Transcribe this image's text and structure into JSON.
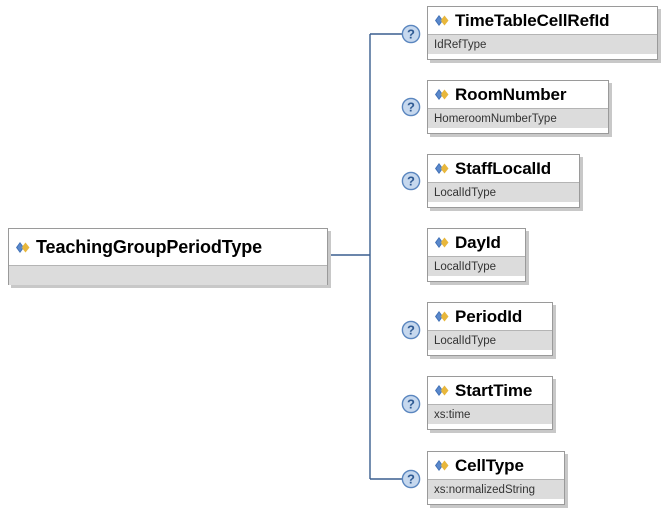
{
  "root": {
    "name": "TeachingGroupPeriodType",
    "type": ""
  },
  "children": [
    {
      "name": "TimeTableCellRefId",
      "type": "IdRefType",
      "optional": true,
      "annotation_icon": "help-question-icon"
    },
    {
      "name": "RoomNumber",
      "type": "HomeroomNumberType",
      "optional": true,
      "annotation_icon": "help-question-icon"
    },
    {
      "name": "StaffLocalId",
      "type": "LocalIdType",
      "optional": true,
      "annotation_icon": "help-question-icon"
    },
    {
      "name": "DayId",
      "type": "LocalIdType",
      "optional": false
    },
    {
      "name": "PeriodId",
      "type": "LocalIdType",
      "optional": true,
      "annotation_icon": "help-question-icon"
    },
    {
      "name": "StartTime",
      "type": "xs:time",
      "optional": true,
      "annotation_icon": "help-question-icon"
    },
    {
      "name": "CellType",
      "type": "xs:normalizedString",
      "optional": true,
      "annotation_icon": "help-question-icon"
    }
  ],
  "icons": {
    "element": "element-diamond-icon",
    "annotation": "help-question-icon"
  },
  "colors": {
    "connector": "#3a5f8f",
    "node_border": "#9a9a9a",
    "type_band": "#dcdcdc",
    "help_circle": "#c6d8ee",
    "help_ring": "#5a86bf"
  }
}
